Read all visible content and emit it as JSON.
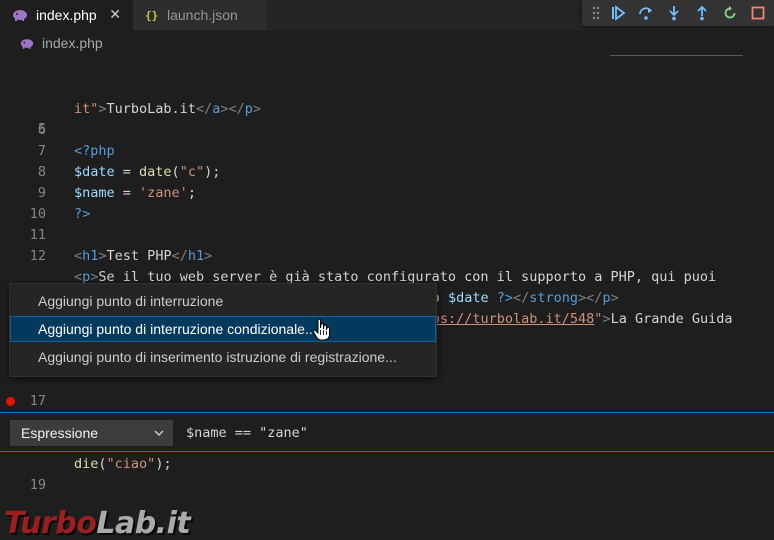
{
  "tabs": [
    {
      "label": "index.php",
      "active": true,
      "icon": "php-elephant-icon",
      "close_glyph": "✕"
    },
    {
      "label": "launch.json",
      "active": false,
      "icon": "json-braces-icon"
    }
  ],
  "debug_toolbar": {
    "buttons": [
      "drag-grip",
      "continue",
      "step-over",
      "step-into",
      "step-out",
      "restart",
      "stop"
    ]
  },
  "breadcrumb": {
    "file": "index.php"
  },
  "editor": {
    "lines": [
      {
        "num": "",
        "text": "it\">TurboLab.it</a></p>"
      },
      {
        "num": "5",
        "text": ""
      },
      {
        "num": "6",
        "text": "<?php"
      },
      {
        "num": "7",
        "text": "$date = date(\"c\");"
      },
      {
        "num": "8",
        "text": "$name = 'zane';"
      },
      {
        "num": "9",
        "text": "?>"
      },
      {
        "num": "10",
        "text": ""
      },
      {
        "num": "11",
        "text": "<h1>Test PHP</h1>"
      },
      {
        "num": "12",
        "text": "<p>Se il tuo web server è già stato configurato con il supporto a PHP, qui puoi"
      },
      {
        "num": "",
        "text": "leggere la data attuale => <strong><?php echo $date ?></strong></p>"
      },
      {
        "num": "13",
        "text": "<p>Per la guida completa, leggi <a href=\"https://turbolab.it/548\">La Grande Guida"
      },
      {
        "num": "17",
        "text": "<?php"
      },
      {
        "num": "18",
        "text": "die(\"ciao\");"
      },
      {
        "num": "19",
        "text": ""
      }
    ]
  },
  "context_menu": {
    "items": [
      {
        "label": "Aggiungi punto di interruzione",
        "highlighted": false
      },
      {
        "label": "Aggiungi punto di interruzione condizionale...",
        "highlighted": true
      },
      {
        "label": "Aggiungi punto di inserimento istruzione di registrazione...",
        "highlighted": false
      }
    ]
  },
  "breakpoint_widget": {
    "type_select": "Espressione",
    "condition": "$name == \"zane\""
  },
  "watermark": {
    "part1": "Turbo",
    "part2": "Lab.it"
  },
  "colors": {
    "accent": "#1177bb",
    "menu_highlight": "#04395e",
    "breakpoint": "#e51400"
  }
}
